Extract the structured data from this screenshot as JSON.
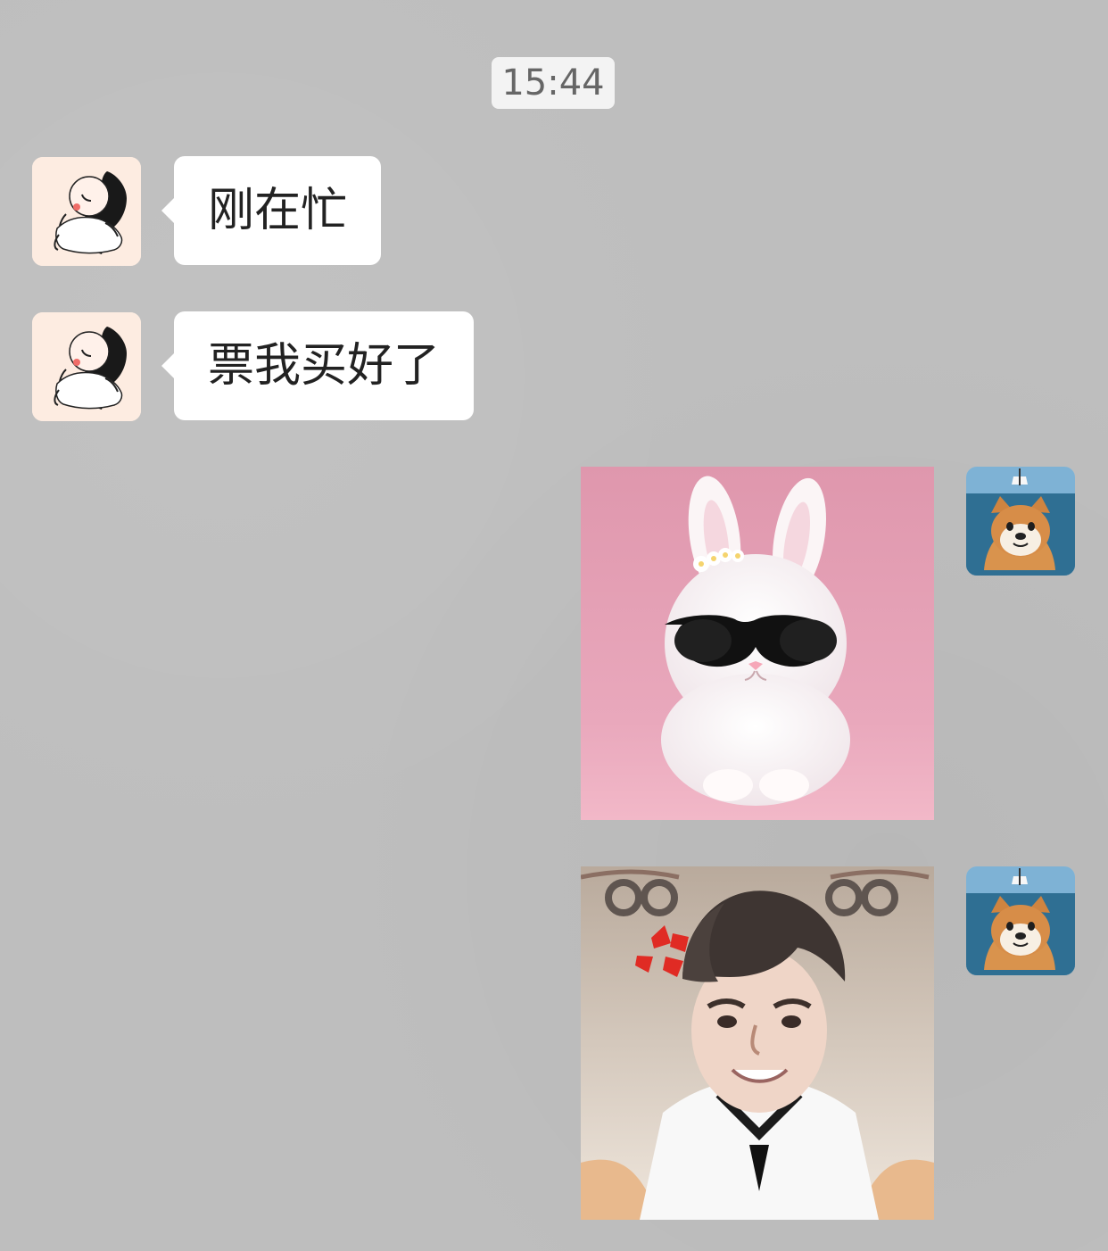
{
  "chat": {
    "timestamp": "15:44",
    "messages": [
      {
        "sender": "incoming",
        "text": "刚在忙"
      },
      {
        "sender": "incoming",
        "text": "票我买好了"
      },
      {
        "sender": "outgoing",
        "media": "bunny-sunglasses-image"
      },
      {
        "sender": "outgoing",
        "media": "young-man-angry-emoji-image"
      }
    ],
    "avatars": {
      "incoming": "cartoon-girl-avatar",
      "outgoing": "shiba-dog-avatar"
    }
  }
}
